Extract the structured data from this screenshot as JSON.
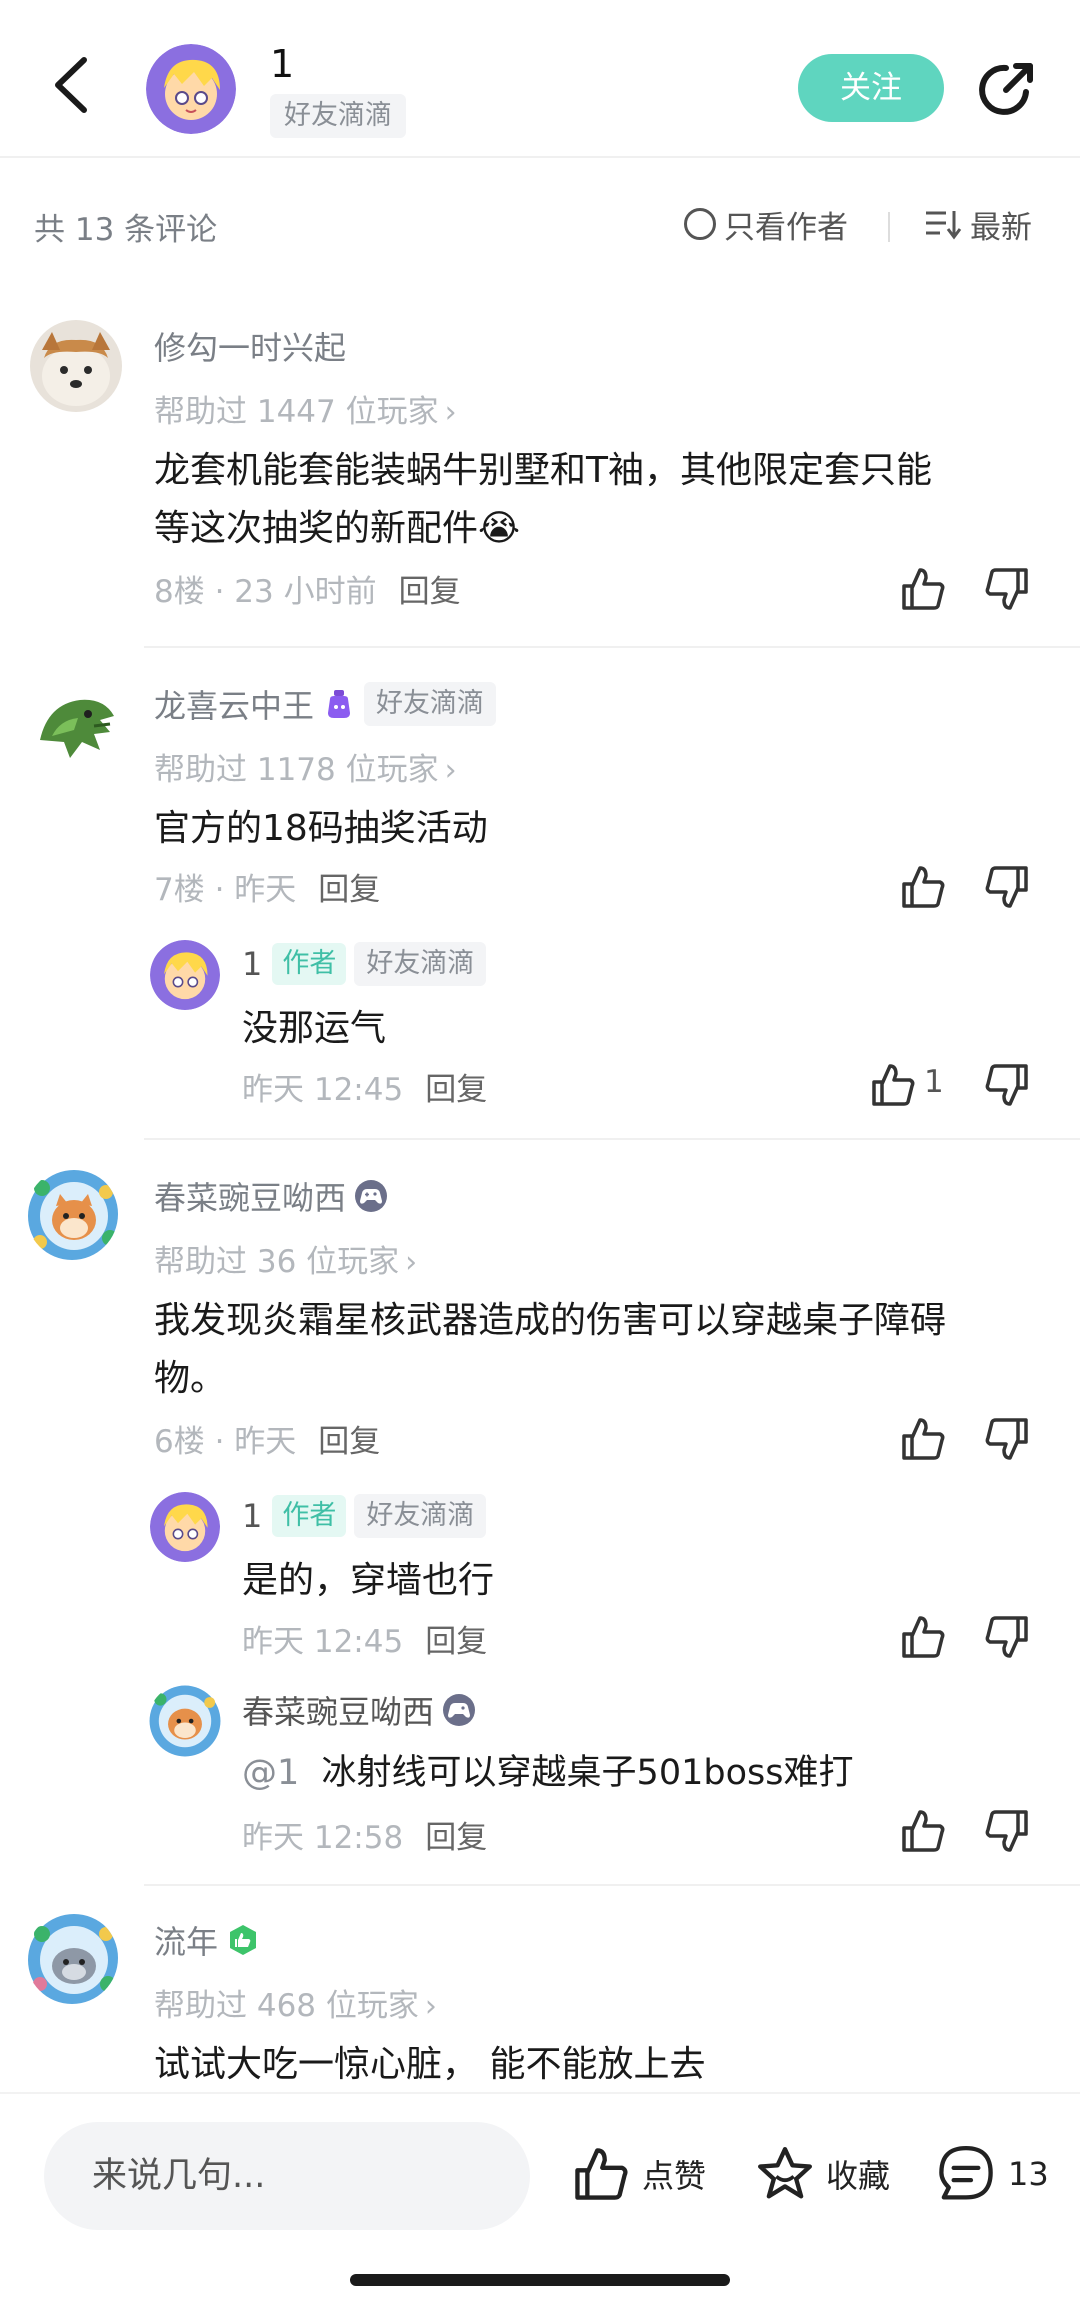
{
  "header": {
    "author_name": "1",
    "author_tag": "好友滴滴",
    "follow_label": "关注"
  },
  "filter": {
    "count_label": "共 13 条评论",
    "author_only_label": "只看作者",
    "sort_label": "最新"
  },
  "comments": [
    {
      "name": "修勾一时兴起",
      "helped": "帮助过 1447 位玩家",
      "content_line1": "龙套机能套能装蜗牛别墅和T袖，其他限定套只能",
      "content_line2": "等这次抽奖的新配件😭",
      "meta": "8楼 · 23 小时前",
      "reply_label": "回复"
    },
    {
      "name": "龙喜云中王",
      "tag": "好友滴滴",
      "helped": "帮助过 1178 位玩家",
      "content": "官方的18码抽奖活动",
      "meta": "7楼 · 昨天",
      "reply_label": "回复",
      "replies": [
        {
          "name": "1",
          "author_badge": "作者",
          "tag": "好友滴滴",
          "content": "没那运气",
          "meta": "昨天 12:45",
          "reply_label": "回复",
          "like_count": "1"
        }
      ]
    },
    {
      "name": "春菜豌豆呦西",
      "helped": "帮助过 36 位玩家",
      "content_line1": "我发现炎霜星核武器造成的伤害可以穿越桌子障碍",
      "content_line2": "物。",
      "meta": "6楼 · 昨天",
      "reply_label": "回复",
      "replies": [
        {
          "name": "1",
          "author_badge": "作者",
          "tag": "好友滴滴",
          "content": "是的，穿墙也行",
          "meta": "昨天 12:45",
          "reply_label": "回复"
        },
        {
          "name": "春菜豌豆呦西",
          "mention": "@1",
          "content": "冰射线可以穿越桌子501boss难打",
          "meta": "昨天 12:58",
          "reply_label": "回复"
        }
      ]
    },
    {
      "name": "流年",
      "helped": "帮助过 468 位玩家",
      "content": "试试大吃一惊心脏， 能不能放上去"
    }
  ],
  "bottom": {
    "input_placeholder": "来说几句...",
    "like_label": "点赞",
    "favorite_label": "收藏",
    "comment_count": "13"
  },
  "colors": {
    "accent": "#5fd5bf",
    "author_badge_bg": "#e4f8f3",
    "author_badge_text": "#3fbfa6"
  }
}
